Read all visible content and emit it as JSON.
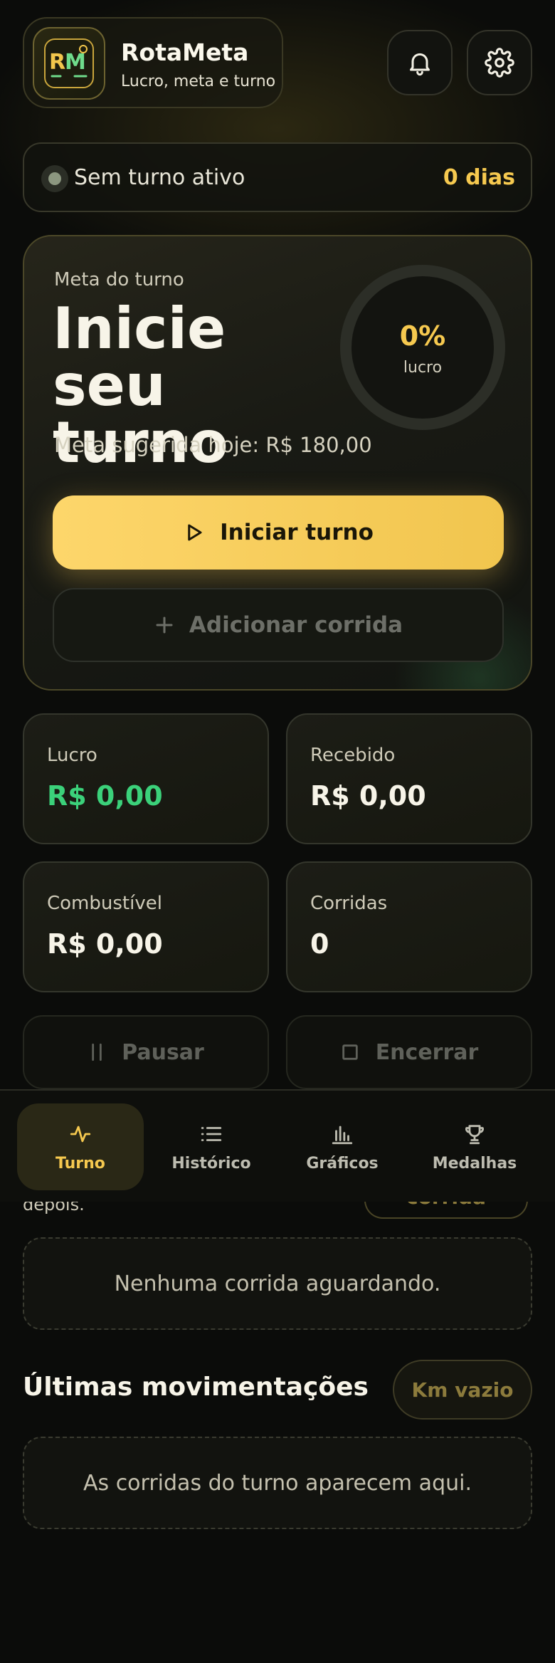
{
  "header": {
    "app_name": "RotaMeta",
    "tagline": "Lucro, meta e turno",
    "logo_text": "RM"
  },
  "status": {
    "text": "Sem turno ativo",
    "days": "0 dias"
  },
  "hero": {
    "label": "Meta do turno",
    "title": "Inicie seu turno",
    "suggested": "Meta sugerida hoje: R$ 180,00",
    "progress_percent": 0,
    "progress_text": "0%",
    "progress_label": "lucro",
    "start_button": "Iniciar turno",
    "add_button": "Adicionar corrida"
  },
  "stats": [
    {
      "label": "Lucro",
      "value": "R$ 0,00"
    },
    {
      "label": "Recebido",
      "value": "R$ 0,00"
    },
    {
      "label": "Combustível",
      "value": "R$ 0,00"
    },
    {
      "label": "Corridas",
      "value": "0"
    }
  ],
  "controls": {
    "pause": "Pausar",
    "end": "Encerrar"
  },
  "nav": [
    {
      "label": "Turno",
      "icon": "activity-icon",
      "active": true
    },
    {
      "label": "Histórico",
      "icon": "list-icon",
      "active": false
    },
    {
      "label": "Gráficos",
      "icon": "bar-chart-icon",
      "active": false
    },
    {
      "label": "Medalhas",
      "icon": "trophy-icon",
      "active": false
    }
  ],
  "pending": {
    "hint_partial": "depois.",
    "peek_button_partial": "corrida",
    "empty_text": "Nenhuma corrida aguardando."
  },
  "movements": {
    "title": "Últimas movimentações",
    "km_button": "Km vazio",
    "empty_text": "As corridas do turno aparecem aqui."
  },
  "colors": {
    "accent": "#f6c94f",
    "profit_green": "#3bd17a",
    "background": "#0b0c0a"
  }
}
